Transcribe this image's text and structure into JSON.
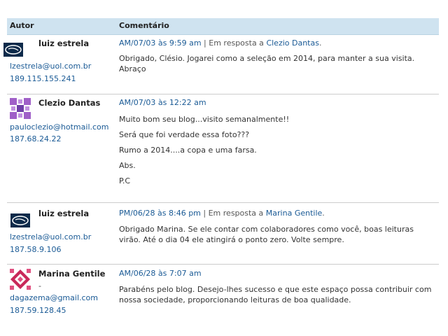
{
  "header": {
    "author": "Autor",
    "comment": "Comentário"
  },
  "comments": [
    {
      "name": "luiz estrela",
      "email": "lzestrela@uol.com.br",
      "ip": "189.115.155.241",
      "date": "AM/07/03 às 9:59 am",
      "reply_sep": "| Em resposta a",
      "reply_to": "Clezio Dantas",
      "text": "Obrigado, Clésio. Jogarei como a seleção em 2014, para manter a sua visita. Abraço"
    },
    {
      "name": "Clezio Dantas",
      "email": "pauloclezio@hotmail.com",
      "ip": "187.68.24.22",
      "date": "AM/07/03 às 12:22 am",
      "paragraphs": [
        "Muito bom seu blog...visito semanalmente!!",
        "Será que foi verdade essa foto???",
        "Rumo a 2014....a copa e uma farsa.",
        "Abs.",
        "P.C"
      ]
    },
    {
      "name": "luiz estrela",
      "email": "lzestrela@uol.com.br",
      "ip": "187.58.9.106",
      "date": "PM/06/28 às 8:46 pm",
      "reply_sep": "| Em resposta a",
      "reply_to": "Marina Gentile",
      "text": "Obrigado Marina. Se ele contar com colaboradores como você, boas leituras virão. Até o dia 04 ele atingirá o ponto zero. Volte sempre."
    },
    {
      "name": "Marina Gentile",
      "dash": "-",
      "email": "dagazema@gmail.com",
      "ip": "187.59.128.45",
      "date": "AM/06/28 às 7:07 am",
      "text": "Parabéns pelo blog. Desejo-lhes sucesso e que este espaço possa contribuir com nossa sociedade, proporcionando leituras de boa qualidade."
    }
  ]
}
